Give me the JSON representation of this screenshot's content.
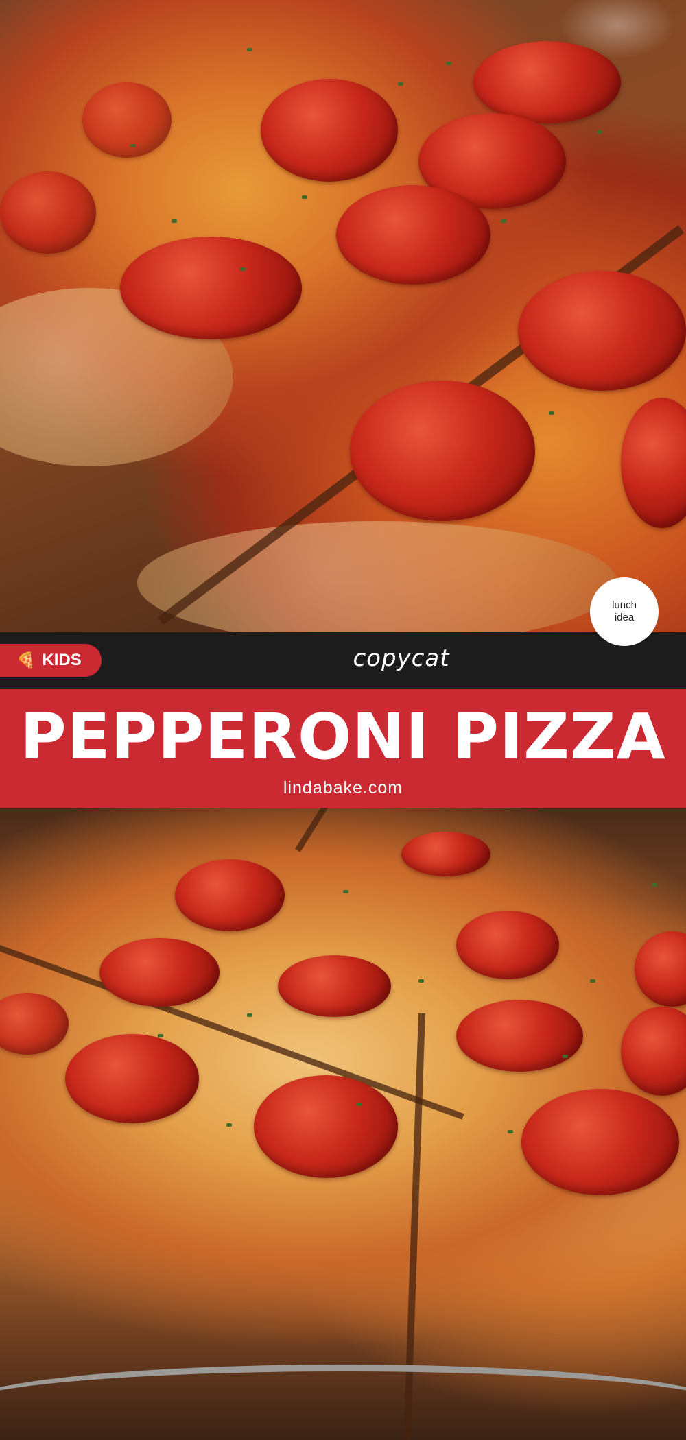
{
  "badge": {
    "text": "lunch\nidea"
  },
  "tag": {
    "icon": "pizza-slice-icon",
    "label": "KIDS"
  },
  "band": {
    "subtitle": "copycat"
  },
  "header": {
    "title": "PEPPERONI PIZZA",
    "website": "lindabake.com"
  },
  "colors": {
    "accent_red": "#cc2a32",
    "dark_band": "#1c1c1c",
    "text": "#ffffff"
  }
}
